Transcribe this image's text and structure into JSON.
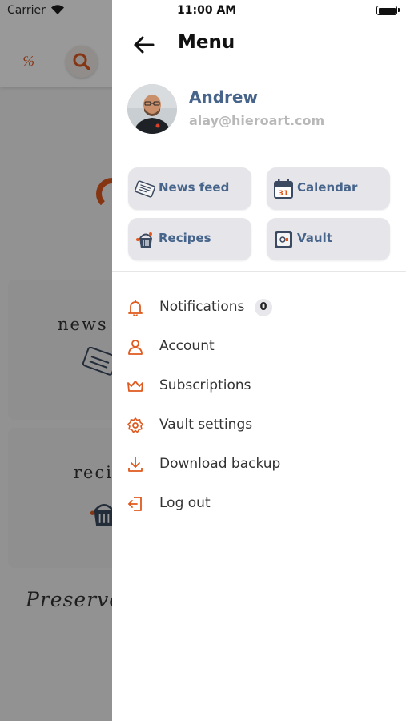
{
  "status_bar": {
    "carrier": "Carrier",
    "time": "11:00 AM"
  },
  "background": {
    "logo_text": "℅",
    "card_1_title": "news f",
    "card_2_title": "recip",
    "footer_text": "Preserve"
  },
  "drawer": {
    "title": "Menu",
    "profile": {
      "name": "Andrew",
      "email": "alay@hieroart.com"
    },
    "tiles": [
      {
        "label": "News feed",
        "icon": "newspaper-icon"
      },
      {
        "label": "Calendar",
        "icon": "calendar-icon"
      },
      {
        "label": "Recipes",
        "icon": "recipe-basket-icon"
      },
      {
        "label": "Vault",
        "icon": "vault-icon"
      }
    ],
    "calendar_day": "31",
    "menu_items": [
      {
        "label": "Notifications",
        "icon": "bell-icon",
        "badge": "0"
      },
      {
        "label": "Account",
        "icon": "person-icon"
      },
      {
        "label": "Subscriptions",
        "icon": "crown-icon"
      },
      {
        "label": "Vault settings",
        "icon": "gear-icon"
      },
      {
        "label": "Download backup",
        "icon": "download-icon"
      },
      {
        "label": "Log out",
        "icon": "logout-icon"
      }
    ]
  },
  "colors": {
    "accent": "#e0591e",
    "tile_text": "#47648a",
    "tile_bg": "#e5e5ea"
  }
}
